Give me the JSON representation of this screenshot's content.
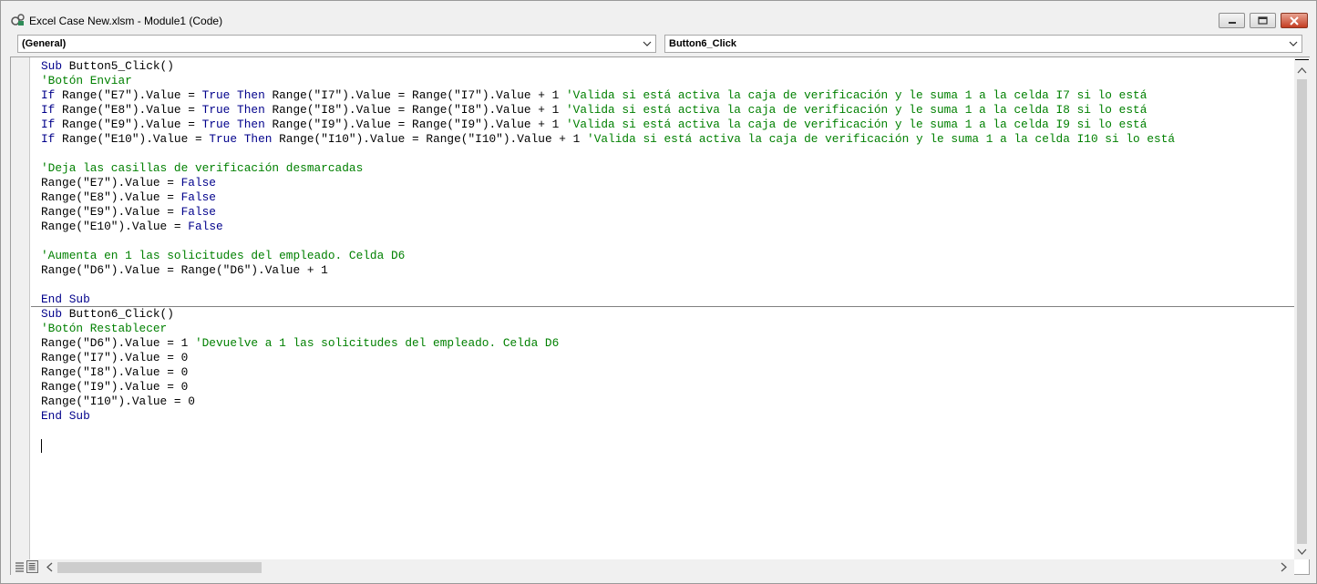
{
  "window": {
    "title": "Excel Case New.xlsm - Module1 (Code)",
    "controls": [
      "minimize-button",
      "maximize-button",
      "close-button"
    ]
  },
  "toolbar": {
    "object_combo": {
      "value": "(General)"
    },
    "procedure_combo": {
      "value": "Button6_Click"
    }
  },
  "code": {
    "l0": [
      {
        "t": "Sub ",
        "k": "kw"
      },
      {
        "t": "Button5_Click()"
      }
    ],
    "l1": [
      {
        "t": "'Botón Enviar",
        "k": "cm"
      }
    ],
    "l2": [
      {
        "t": "If ",
        "k": "kw"
      },
      {
        "t": "Range(\"E7\").Value = "
      },
      {
        "t": "True Then ",
        "k": "kw"
      },
      {
        "t": "Range(\"I7\").Value = Range(\"I7\").Value + 1 "
      },
      {
        "t": "'Valida si está activa la caja de verificación y le suma 1 a la celda I7 si lo está",
        "k": "cm"
      }
    ],
    "l3": [
      {
        "t": "If ",
        "k": "kw"
      },
      {
        "t": "Range(\"E8\").Value = "
      },
      {
        "t": "True Then ",
        "k": "kw"
      },
      {
        "t": "Range(\"I8\").Value = Range(\"I8\").Value + 1 "
      },
      {
        "t": "'Valida si está activa la caja de verificación y le suma 1 a la celda I8 si lo está",
        "k": "cm"
      }
    ],
    "l4": [
      {
        "t": "If ",
        "k": "kw"
      },
      {
        "t": "Range(\"E9\").Value = "
      },
      {
        "t": "True Then ",
        "k": "kw"
      },
      {
        "t": "Range(\"I9\").Value = Range(\"I9\").Value + 1 "
      },
      {
        "t": "'Valida si está activa la caja de verificación y le suma 1 a la celda I9 si lo está",
        "k": "cm"
      }
    ],
    "l5": [
      {
        "t": "If ",
        "k": "kw"
      },
      {
        "t": "Range(\"E10\").Value = "
      },
      {
        "t": "True Then ",
        "k": "kw"
      },
      {
        "t": "Range(\"I10\").Value = Range(\"I10\").Value + 1 "
      },
      {
        "t": "'Valida si está activa la caja de verificación y le suma 1 a la celda I10 si lo está",
        "k": "cm"
      }
    ],
    "l6": [],
    "l7": [
      {
        "t": "'Deja las casillas de verificación desmarcadas",
        "k": "cm"
      }
    ],
    "l8": [
      {
        "t": "Range(\"E7\").Value = "
      },
      {
        "t": "False",
        "k": "kw"
      }
    ],
    "l9": [
      {
        "t": "Range(\"E8\").Value = "
      },
      {
        "t": "False",
        "k": "kw"
      }
    ],
    "l10": [
      {
        "t": "Range(\"E9\").Value = "
      },
      {
        "t": "False",
        "k": "kw"
      }
    ],
    "l11": [
      {
        "t": "Range(\"E10\").Value = "
      },
      {
        "t": "False",
        "k": "kw"
      }
    ],
    "l12": [],
    "l13": [
      {
        "t": "'Aumenta en 1 las solicitudes del empleado. Celda D6",
        "k": "cm"
      }
    ],
    "l14": [
      {
        "t": "Range(\"D6\").Value = Range(\"D6\").Value + 1"
      }
    ],
    "l15": [],
    "l16": [
      {
        "t": "End Sub",
        "k": "kw"
      }
    ],
    "l17": [
      {
        "t": "Sub ",
        "k": "kw"
      },
      {
        "t": "Button6_Click()"
      }
    ],
    "l18": [
      {
        "t": "'Botón Restablecer",
        "k": "cm"
      }
    ],
    "l19": [
      {
        "t": "Range(\"D6\").Value = 1 "
      },
      {
        "t": "'Devuelve a 1 las solicitudes del empleado. Celda D6",
        "k": "cm"
      }
    ],
    "l20": [
      {
        "t": "Range(\"I7\").Value = 0"
      }
    ],
    "l21": [
      {
        "t": "Range(\"I8\").Value = 0"
      }
    ],
    "l22": [
      {
        "t": "Range(\"I9\").Value = 0"
      }
    ],
    "l23": [
      {
        "t": "Range(\"I10\").Value = 0"
      }
    ],
    "l24": [
      {
        "t": "End Sub",
        "k": "kw"
      }
    ]
  },
  "colors": {
    "keyword": "#00008b",
    "comment": "#008000",
    "text": "#000000"
  }
}
